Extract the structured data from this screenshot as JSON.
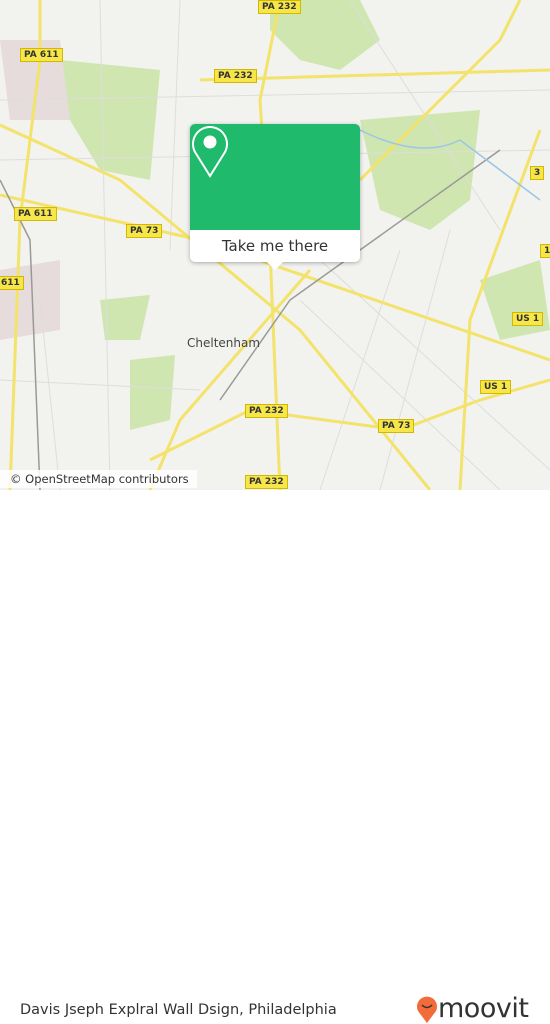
{
  "map": {
    "place_label": "Cheltenham",
    "shields": [
      "PA 232",
      "PA 611",
      "PA 232",
      "PA 611",
      "PA 73",
      "611",
      "PA 232",
      "PA 73",
      "US 1",
      "US 1",
      "1",
      "3",
      "PA 232"
    ],
    "attribution": "© OpenStreetMap contributors",
    "colors": {
      "road": "#f3e36a",
      "park": "#cfe6b0",
      "background": "#f2f2ef"
    }
  },
  "popup": {
    "icon": "map-pin-icon",
    "button_label": "Take me there",
    "color": "#1fba6b"
  },
  "footer": {
    "title": "Davis Jseph Explral Wall Dsign, Philadelphia",
    "logo_text": "moovit",
    "logo_color": "#f26b3a"
  }
}
